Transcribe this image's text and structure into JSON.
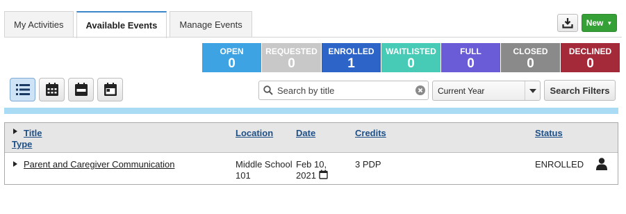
{
  "tabs": [
    {
      "label": "My Activities"
    },
    {
      "label": "Available Events"
    },
    {
      "label": "Manage Events"
    }
  ],
  "toolbar": {
    "new_label": "New"
  },
  "status_tiles": [
    {
      "label": "OPEN",
      "count": "0",
      "color": "#3da3e3"
    },
    {
      "label": "REQUESTED",
      "count": "0",
      "color": "#c8c8c8"
    },
    {
      "label": "ENROLLED",
      "count": "1",
      "color": "#2d64c8"
    },
    {
      "label": "WAITLISTED",
      "count": "0",
      "color": "#47cbb6"
    },
    {
      "label": "FULL",
      "count": "0",
      "color": "#6a5bd6"
    },
    {
      "label": "CLOSED",
      "count": "0",
      "color": "#8a8a8a"
    },
    {
      "label": "DECLINED",
      "count": "0",
      "color": "#a42a3a"
    }
  ],
  "search": {
    "placeholder": "Search by title"
  },
  "year_filter": {
    "value": "Current Year"
  },
  "filters_label": "Search Filters",
  "table": {
    "headers": {
      "title": "Title",
      "type": "Type",
      "location": "Location",
      "date": "Date",
      "credits": "Credits",
      "status": "Status"
    },
    "rows": [
      {
        "title": "Parent and Caregiver Communication",
        "location_line1": "Middle School",
        "location_line2": "101",
        "date_line1": "Feb 10,",
        "date_line2": "2021",
        "credits": "3 PDP",
        "status": "ENROLLED"
      }
    ]
  }
}
